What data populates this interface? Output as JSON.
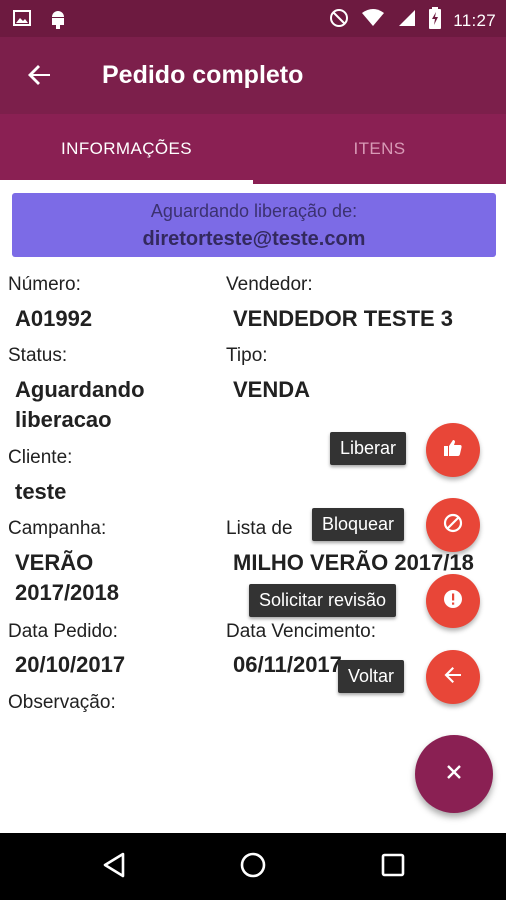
{
  "status_bar": {
    "time": "11:27",
    "icons": [
      "image-icon",
      "android-icon",
      "do-not-disturb-icon",
      "wifi-icon",
      "signal-icon",
      "battery-charging-icon"
    ]
  },
  "app_bar": {
    "title": "Pedido completo",
    "back_icon": "arrow-back-icon"
  },
  "tabs": [
    {
      "label": "INFORMAÇÕES",
      "active": true
    },
    {
      "label": "ITENS",
      "active": false
    }
  ],
  "banner": {
    "line1": "Aguardando liberação de:",
    "email": "diretorteste@teste.com"
  },
  "fields": {
    "numero": {
      "label": "Número:",
      "value": "A01992"
    },
    "vendedor": {
      "label": "Vendedor:",
      "value": "VENDEDOR TESTE 3"
    },
    "status": {
      "label": "Status:",
      "value_line1": "Aguardando",
      "value_line2": "liberacao"
    },
    "tipo": {
      "label": "Tipo:",
      "value": "VENDA"
    },
    "cliente": {
      "label": "Cliente:",
      "value": "teste"
    },
    "campanha": {
      "label": "Campanha:",
      "value_line1": "VERÃO",
      "value_line2": "2017/2018"
    },
    "lista": {
      "label": "Lista de",
      "value": "MILHO VERÃO 2017/18"
    },
    "data_pedido": {
      "label": "Data Pedido:",
      "value": "20/10/2017"
    },
    "data_vencimento": {
      "label": "Data Vencimento:",
      "value": "06/11/2017"
    },
    "observacao": {
      "label": "Observação:"
    }
  },
  "fab_actions": [
    {
      "label": "Liberar",
      "icon": "thumbs-up-icon"
    },
    {
      "label": "Bloquear",
      "icon": "block-icon"
    },
    {
      "label": "Solicitar revisão",
      "icon": "alert-icon"
    },
    {
      "label": "Voltar",
      "icon": "arrow-back-icon"
    }
  ],
  "main_fab": {
    "icon": "close-icon"
  },
  "colors": {
    "status_bar": "#6d1a40",
    "app_bar": "#7c1f4b",
    "tabs": "#8a2053",
    "banner": "#7c6be6",
    "mini_fab": "#e84638",
    "main_fab": "#8a2053"
  }
}
